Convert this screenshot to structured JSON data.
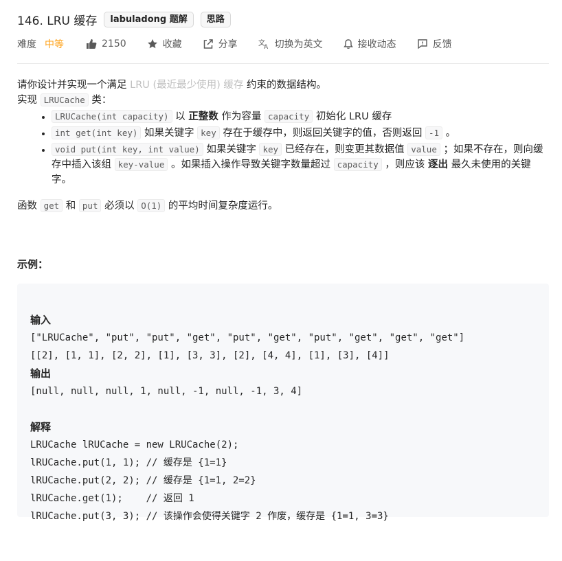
{
  "problem": {
    "title": "146. LRU 缓存",
    "tags": [
      "labuladong 题解",
      "思路"
    ]
  },
  "meta": {
    "difficulty_label": "难度",
    "difficulty_value": "中等",
    "likes": "2150",
    "favorite": "收藏",
    "share": "分享",
    "translate": "切换为英文",
    "subscribe": "接收动态",
    "feedback": "反馈"
  },
  "description": {
    "intro_pre": "请你设计并实现一个满足 ",
    "intro_link": "LRU (最近最少使用) 缓存",
    "intro_post": " 约束的数据结构。",
    "impl_pre": "实现 ",
    "impl_code": "LRUCache",
    "impl_post": " 类：",
    "b1_code1": "LRUCache(int capacity)",
    "b1_t1": " 以 ",
    "b1_bold": "正整数",
    "b1_t2": " 作为容量 ",
    "b1_code2": "capacity",
    "b1_t3": " 初始化 LRU 缓存",
    "b2_code1": "int get(int key)",
    "b2_t1": " 如果关键字 ",
    "b2_code2": "key",
    "b2_t2": " 存在于缓存中，则返回关键字的值，否则返回 ",
    "b2_code3": "-1",
    "b2_t3": " 。",
    "b3_code1": "void put(int key, int value)",
    "b3_t1": " 如果关键字 ",
    "b3_code2": "key",
    "b3_t2": " 已经存在，则变更其数据值 ",
    "b3_code3": "value",
    "b3_t3": " ；如果不存在，则向缓存中插入该组 ",
    "b3_code4": "key-value",
    "b3_t4": " 。如果插入操作导致关键字数量超过 ",
    "b3_code5": "capacity",
    "b3_t5": " ，则应该 ",
    "b3_bold": "逐出",
    "b3_t6": " 最久未使用的关键字。",
    "fn_pre": "函数 ",
    "fn_code1": "get",
    "fn_t1": " 和 ",
    "fn_code2": "put",
    "fn_t2": " 必须以 ",
    "fn_code3": "O(1)",
    "fn_t3": " 的平均时间复杂度运行。"
  },
  "example": {
    "heading": "示例：",
    "input_label": "输入",
    "input_line1": "[\"LRUCache\", \"put\", \"put\", \"get\", \"put\", \"get\", \"put\", \"get\", \"get\", \"get\"]",
    "input_line2": "[[2], [1, 1], [2, 2], [1], [3, 3], [2], [4, 4], [1], [3], [4]]",
    "output_label": "输出",
    "output_line": "[null, null, null, 1, null, -1, null, -1, 3, 4]",
    "explain_label": "解释",
    "code_lines": [
      "LRUCache lRUCache = new LRUCache(2);",
      "lRUCache.put(1, 1); // 缓存是 {1=1}",
      "lRUCache.put(2, 2); // 缓存是 {1=1, 2=2}",
      "lRUCache.get(1);    // 返回 1",
      "lRUCache.put(3, 3); // 该操作会使得关键字 2 作废，缓存是 {1=1, 3=3}"
    ]
  },
  "colors": {
    "difficulty_medium": "#ffa116",
    "code_bg": "#f7f8fa",
    "link_gray": "#c0c0c0"
  }
}
